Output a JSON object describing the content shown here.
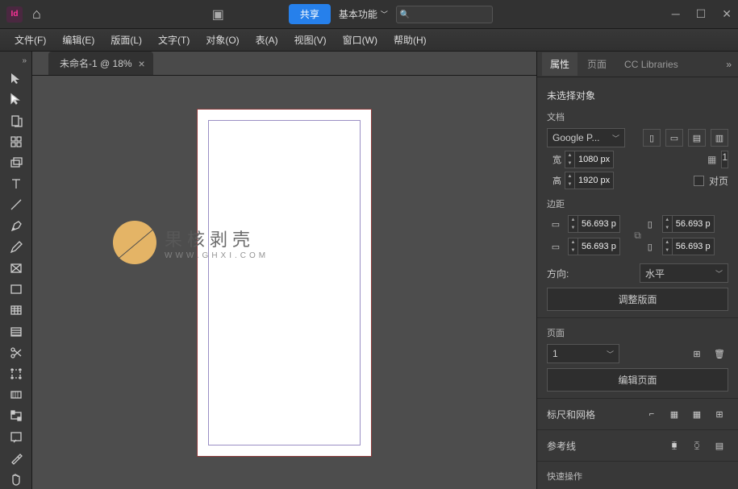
{
  "titlebar": {
    "logo_text": "Id",
    "share_label": "共享",
    "workspace_label": "基本功能"
  },
  "menubar": {
    "items": [
      {
        "label": "文件(F)"
      },
      {
        "label": "编辑(E)"
      },
      {
        "label": "版面(L)"
      },
      {
        "label": "文字(T)"
      },
      {
        "label": "对象(O)"
      },
      {
        "label": "表(A)"
      },
      {
        "label": "视图(V)"
      },
      {
        "label": "窗口(W)"
      },
      {
        "label": "帮助(H)"
      }
    ]
  },
  "document": {
    "tab_label": "未命名-1 @ 18%"
  },
  "watermark": {
    "line1": "果核剥壳",
    "line2": "WWW.GHXI.COM"
  },
  "panel": {
    "tabs": {
      "properties": "属性",
      "pages": "页面",
      "cc": "CC Libraries"
    },
    "no_selection": "未选择对象",
    "doc_section": "文档",
    "preset_value": "Google P...",
    "width_label": "宽",
    "width_value": "1080 px",
    "height_label": "高",
    "height_value": "1920 px",
    "pages_count": "1",
    "facing_label": "对页",
    "margins_label": "边距",
    "margin_top": "56.693 p",
    "margin_bottom": "56.693 p",
    "margin_left": "56.693 p",
    "margin_right": "56.693 p",
    "orientation_label": "方向:",
    "orientation_value": "水平",
    "adjust_layout": "调整版面",
    "pages_section": "页面",
    "page_number": "1",
    "edit_pages": "编辑页面",
    "rulers_section": "标尺和网格",
    "guides_section": "参考线",
    "quick_actions": "快速操作"
  }
}
